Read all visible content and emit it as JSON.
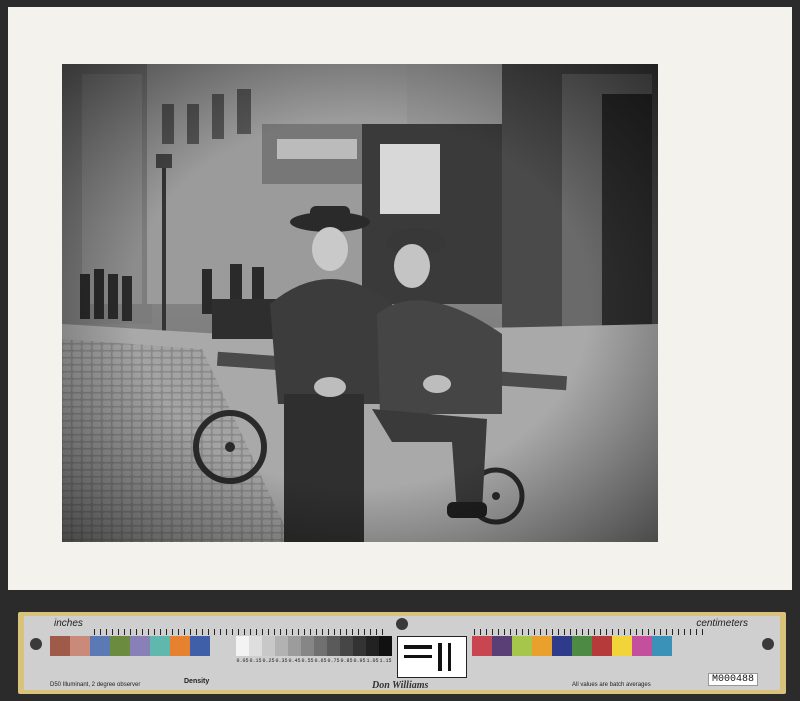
{
  "photograph": {
    "subject": "street-scene-two-boys-on-cart"
  },
  "target": {
    "label_left": "inches",
    "label_right": "centimeters",
    "density_label": "Density",
    "author_signature": "Don Williams",
    "note_left": "D50 Illuminant, 2 degree observer",
    "note_right": "All values are batch averages",
    "catalog_id": "M000488",
    "color_patches": [
      "#a05a4a",
      "#c98a7a",
      "#5b7ab5",
      "#6b8b3f",
      "#8a80b8",
      "#5fb7ad",
      "#e5812f",
      "#3f5fa8",
      "#c8464f",
      "#5a3e76",
      "#a5c64a",
      "#eaa02d",
      "#2e3b8a",
      "#4d8a44",
      "#b63a3a",
      "#f1d33a",
      "#c44f9c",
      "#3a92b8"
    ],
    "gray_patches": [
      "#f3f3f3",
      "#dedede",
      "#c8c8c8",
      "#b2b2b2",
      "#9c9c9c",
      "#868686",
      "#707070",
      "#5a5a5a",
      "#464646",
      "#333333",
      "#222222",
      "#111111"
    ],
    "density_values": [
      "0.05",
      "0.15",
      "0.25",
      "0.35",
      "0.45",
      "0.55",
      "0.65",
      "0.75",
      "0.85",
      "0.95",
      "1.05",
      "1.15"
    ]
  }
}
